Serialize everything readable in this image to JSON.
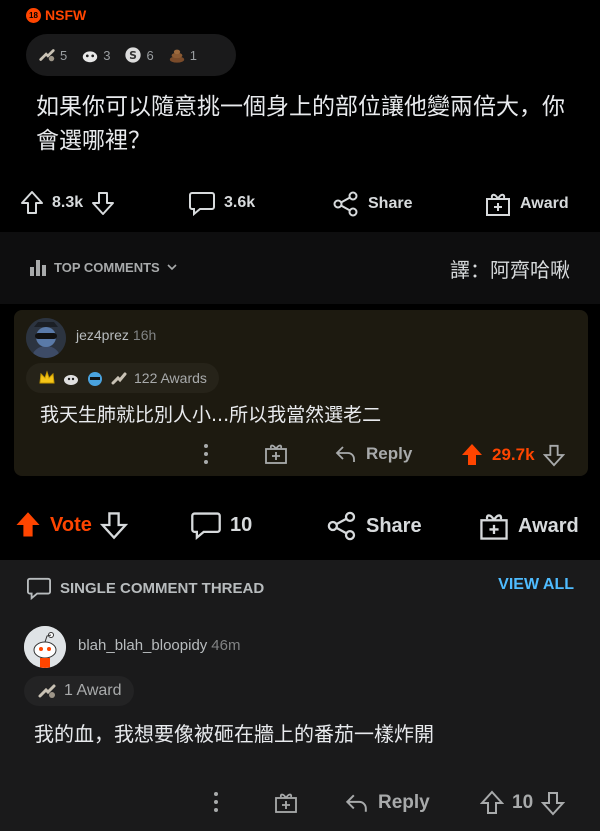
{
  "post": {
    "nsfw_badge_num": "18",
    "nsfw_label": "NSFW",
    "awards": [
      {
        "icon": "helpful-award-icon",
        "count": "5"
      },
      {
        "icon": "wholesome-award-icon",
        "count": "3"
      },
      {
        "icon": "silver-award-icon",
        "count": "6"
      },
      {
        "icon": "poop-award-icon",
        "count": "1"
      }
    ],
    "title": "如果你可以隨意挑一個身上的部位讓他變兩倍大，你會選哪裡？",
    "upvotes": "8.3k",
    "comments": "3.6k",
    "share_label": "Share",
    "award_label": "Award"
  },
  "top_comments": {
    "label": "TOP COMMENTS",
    "translator": "譯：阿齊哈啾"
  },
  "top_comment": {
    "username": "jez4prez",
    "time": "16h",
    "awards_label": "122 Awards",
    "body": "我天生肺就比別人小...所以我當然選老二",
    "reply_label": "Reply",
    "score": "29.7k"
  },
  "vote_bar": {
    "vote_label": "Vote",
    "comments": "10",
    "share_label": "Share",
    "award_label": "Award"
  },
  "thread": {
    "label": "SINGLE COMMENT THREAD",
    "view_all": "VIEW ALL"
  },
  "single_comment": {
    "username": "blah_blah_bloopidy",
    "time": "46m",
    "awards_label": "1 Award",
    "body": "我的血，我想要像被砸在牆上的番茄一樣炸開",
    "reply_label": "Reply",
    "score": "10"
  },
  "colors": {
    "accent_orange": "#ff4500",
    "link_blue": "#4fbcff",
    "background": "#000000",
    "panel": "#1a1a1b"
  }
}
